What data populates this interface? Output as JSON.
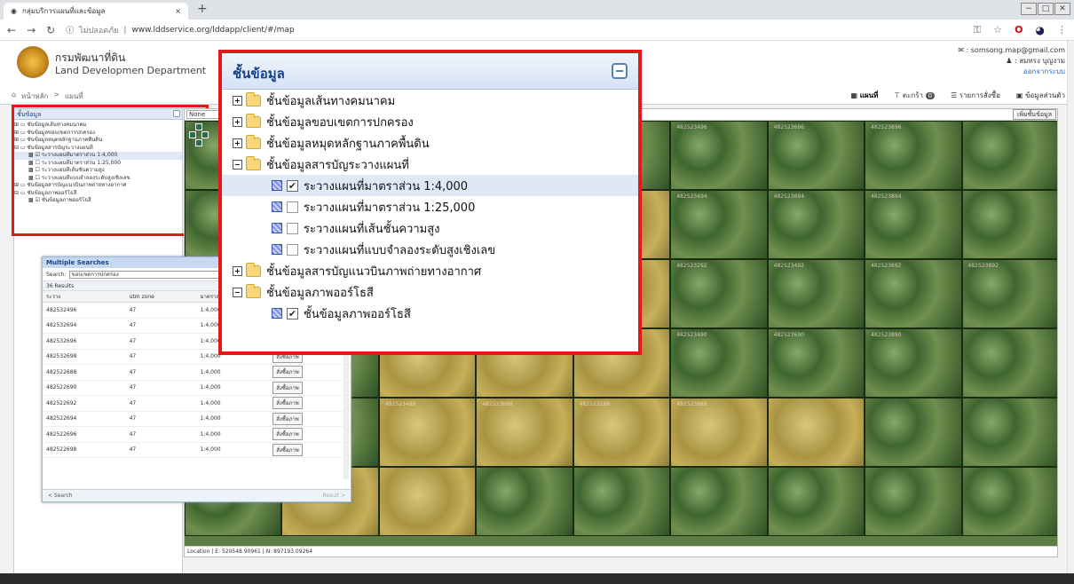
{
  "browser": {
    "tab_title": "กลุ่มบริการแผนที่และข้อมูล",
    "tab_close": "×",
    "new_tab": "+",
    "win_min": "−",
    "win_max": "□",
    "win_close": "✕",
    "security": "ไม่ปลอดภัย",
    "url": "www.lddservice.org/lddapp/client/#/map"
  },
  "header": {
    "dept_th": "กรมพัฒนาที่ดิน",
    "dept_en": "Land Developmen Department",
    "email": "somsong.map@gmail.com",
    "user": "สมทรง บุญงาม",
    "logout": "ออกจากระบบ"
  },
  "nav": {
    "home": "หน้าหลัก",
    "sep": ">",
    "current": "แผนที่",
    "tabs": [
      {
        "label": "แผนที่"
      },
      {
        "label": "ตะกร้า"
      },
      {
        "label": "รายการสั่งซื้อ"
      },
      {
        "label": "ข้อมูลส่วนตัว"
      }
    ],
    "cart_count": "0"
  },
  "layer_panel": {
    "title": "ชั้นข้อมูล",
    "items": [
      "ชั้นข้อมูลเส้นทางคมนาคม",
      "ชั้นข้อมูลขอบเขตการปกครอง",
      "ชั้นข้อมูลหมุดหลักฐานภาคพื้นดิน",
      "ชั้นข้อมูลสารบัญระวางแผนที่",
      "ระวางแผนที่มาตราส่วน 1:4,000",
      "ระวางแผนที่มาตราส่วน 1:25,000",
      "ระวางแผนที่เส้นชั้นความสูง",
      "ระวางแผนที่แบบจำลองระดับสูงเชิงเลข",
      "ชั้นข้อมูลสารบัญแนวบินภาพถ่ายทางอากาศ",
      "ชั้นข้อมูลภาพออร์โธสี",
      "ชั้นข้อมูลภาพออร์โธสี"
    ]
  },
  "map": {
    "select_value": "None",
    "add_layer": "เพิ่มชั้นข้อมูล",
    "location_label": "Location",
    "easting": "E: 520548.90961",
    "northing": "N: 897193.09264",
    "tile_labels": [
      "482532896",
      "4825232296",
      "482523496",
      "482523696",
      "482523896",
      "482523292",
      "482523494",
      "482523694",
      "482523894",
      "482523292",
      "482523492",
      "482523692",
      "482523892",
      "482523490",
      "482523690",
      "482523890",
      "482523488",
      "482523688",
      "482523288",
      "482523888"
    ]
  },
  "multi_search": {
    "title": "Multiple Searches",
    "search_label": "Search:",
    "search_value": "ขอบเขตการปกครอง",
    "results_count": "36 Results",
    "columns": [
      "ระวาง",
      "utm zone",
      "มาตราส่วน"
    ],
    "rows": [
      {
        "id": "482532496",
        "zone": "47",
        "scale": "1:4,000"
      },
      {
        "id": "482532694",
        "zone": "47",
        "scale": "1:4,000"
      },
      {
        "id": "482532696",
        "zone": "47",
        "scale": "1:4,000"
      },
      {
        "id": "482532698",
        "zone": "47",
        "scale": "1:4,000"
      },
      {
        "id": "482522688",
        "zone": "47",
        "scale": "1:4,000"
      },
      {
        "id": "482522690",
        "zone": "47",
        "scale": "1:4,000"
      },
      {
        "id": "482522692",
        "zone": "47",
        "scale": "1:4,000"
      },
      {
        "id": "482522694",
        "zone": "47",
        "scale": "1:4,000"
      },
      {
        "id": "482522696",
        "zone": "47",
        "scale": "1:4,000"
      },
      {
        "id": "482522698",
        "zone": "47",
        "scale": "1:4,000"
      }
    ],
    "order_label": "สั่งซื้อภาพ",
    "footer_left": "< Search",
    "footer_right": "Result >"
  },
  "callout": {
    "title": "ชั้นข้อมูล",
    "items": [
      {
        "label": "ชั้นข้อมูลเส้นทางคมนาคม"
      },
      {
        "label": "ชั้นข้อมูลขอบเขตการปกครอง"
      },
      {
        "label": "ชั้นข้อมูลหมุดหลักฐานภาคพื้นดิน"
      },
      {
        "label": "ชั้นข้อมูลสารบัญระวางแผนที่"
      },
      {
        "label": "ระวางแผนที่มาตราส่วน 1:4,000"
      },
      {
        "label": "ระวางแผนที่มาตราส่วน 1:25,000"
      },
      {
        "label": "ระวางแผนที่เส้นชั้นความสูง"
      },
      {
        "label": "ระวางแผนที่แบบจำลองระดับสูงเชิงเลข"
      },
      {
        "label": "ชั้นข้อมูลสารบัญแนวบินภาพถ่ายทางอากาศ"
      },
      {
        "label": "ชั้นข้อมูลภาพออร์โธสี"
      },
      {
        "label": "ชั้นข้อมูลภาพออร์โธสี"
      }
    ],
    "check_mark": "✔"
  },
  "colors": {
    "accent": "#15428b",
    "highlight": "#e31818"
  }
}
